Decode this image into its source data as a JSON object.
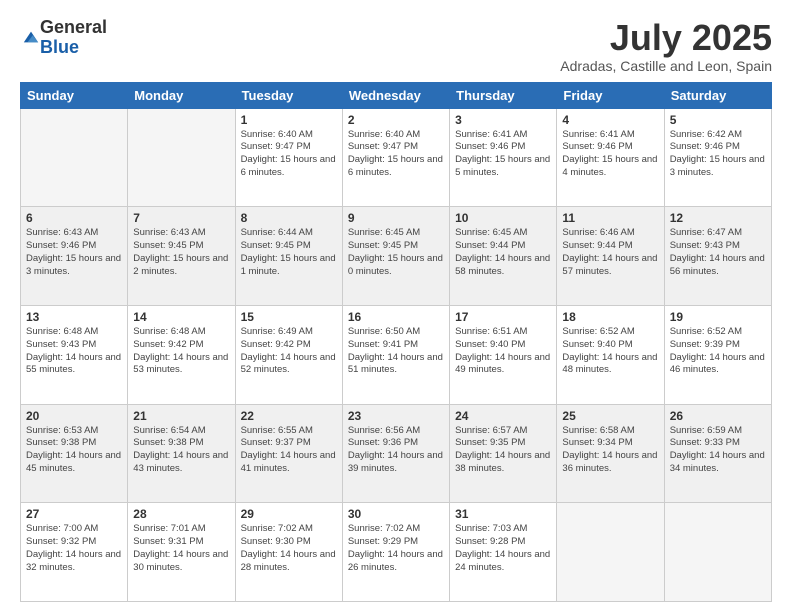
{
  "logo": {
    "general": "General",
    "blue": "Blue"
  },
  "title": "July 2025",
  "location": "Adradas, Castille and Leon, Spain",
  "weekdays": [
    "Sunday",
    "Monday",
    "Tuesday",
    "Wednesday",
    "Thursday",
    "Friday",
    "Saturday"
  ],
  "weeks": [
    [
      {
        "day": "",
        "text": ""
      },
      {
        "day": "",
        "text": ""
      },
      {
        "day": "1",
        "text": "Sunrise: 6:40 AM\nSunset: 9:47 PM\nDaylight: 15 hours\nand 6 minutes."
      },
      {
        "day": "2",
        "text": "Sunrise: 6:40 AM\nSunset: 9:47 PM\nDaylight: 15 hours\nand 6 minutes."
      },
      {
        "day": "3",
        "text": "Sunrise: 6:41 AM\nSunset: 9:46 PM\nDaylight: 15 hours\nand 5 minutes."
      },
      {
        "day": "4",
        "text": "Sunrise: 6:41 AM\nSunset: 9:46 PM\nDaylight: 15 hours\nand 4 minutes."
      },
      {
        "day": "5",
        "text": "Sunrise: 6:42 AM\nSunset: 9:46 PM\nDaylight: 15 hours\nand 3 minutes."
      }
    ],
    [
      {
        "day": "6",
        "text": "Sunrise: 6:43 AM\nSunset: 9:46 PM\nDaylight: 15 hours\nand 3 minutes."
      },
      {
        "day": "7",
        "text": "Sunrise: 6:43 AM\nSunset: 9:45 PM\nDaylight: 15 hours\nand 2 minutes."
      },
      {
        "day": "8",
        "text": "Sunrise: 6:44 AM\nSunset: 9:45 PM\nDaylight: 15 hours\nand 1 minute."
      },
      {
        "day": "9",
        "text": "Sunrise: 6:45 AM\nSunset: 9:45 PM\nDaylight: 15 hours\nand 0 minutes."
      },
      {
        "day": "10",
        "text": "Sunrise: 6:45 AM\nSunset: 9:44 PM\nDaylight: 14 hours\nand 58 minutes."
      },
      {
        "day": "11",
        "text": "Sunrise: 6:46 AM\nSunset: 9:44 PM\nDaylight: 14 hours\nand 57 minutes."
      },
      {
        "day": "12",
        "text": "Sunrise: 6:47 AM\nSunset: 9:43 PM\nDaylight: 14 hours\nand 56 minutes."
      }
    ],
    [
      {
        "day": "13",
        "text": "Sunrise: 6:48 AM\nSunset: 9:43 PM\nDaylight: 14 hours\nand 55 minutes."
      },
      {
        "day": "14",
        "text": "Sunrise: 6:48 AM\nSunset: 9:42 PM\nDaylight: 14 hours\nand 53 minutes."
      },
      {
        "day": "15",
        "text": "Sunrise: 6:49 AM\nSunset: 9:42 PM\nDaylight: 14 hours\nand 52 minutes."
      },
      {
        "day": "16",
        "text": "Sunrise: 6:50 AM\nSunset: 9:41 PM\nDaylight: 14 hours\nand 51 minutes."
      },
      {
        "day": "17",
        "text": "Sunrise: 6:51 AM\nSunset: 9:40 PM\nDaylight: 14 hours\nand 49 minutes."
      },
      {
        "day": "18",
        "text": "Sunrise: 6:52 AM\nSunset: 9:40 PM\nDaylight: 14 hours\nand 48 minutes."
      },
      {
        "day": "19",
        "text": "Sunrise: 6:52 AM\nSunset: 9:39 PM\nDaylight: 14 hours\nand 46 minutes."
      }
    ],
    [
      {
        "day": "20",
        "text": "Sunrise: 6:53 AM\nSunset: 9:38 PM\nDaylight: 14 hours\nand 45 minutes."
      },
      {
        "day": "21",
        "text": "Sunrise: 6:54 AM\nSunset: 9:38 PM\nDaylight: 14 hours\nand 43 minutes."
      },
      {
        "day": "22",
        "text": "Sunrise: 6:55 AM\nSunset: 9:37 PM\nDaylight: 14 hours\nand 41 minutes."
      },
      {
        "day": "23",
        "text": "Sunrise: 6:56 AM\nSunset: 9:36 PM\nDaylight: 14 hours\nand 39 minutes."
      },
      {
        "day": "24",
        "text": "Sunrise: 6:57 AM\nSunset: 9:35 PM\nDaylight: 14 hours\nand 38 minutes."
      },
      {
        "day": "25",
        "text": "Sunrise: 6:58 AM\nSunset: 9:34 PM\nDaylight: 14 hours\nand 36 minutes."
      },
      {
        "day": "26",
        "text": "Sunrise: 6:59 AM\nSunset: 9:33 PM\nDaylight: 14 hours\nand 34 minutes."
      }
    ],
    [
      {
        "day": "27",
        "text": "Sunrise: 7:00 AM\nSunset: 9:32 PM\nDaylight: 14 hours\nand 32 minutes."
      },
      {
        "day": "28",
        "text": "Sunrise: 7:01 AM\nSunset: 9:31 PM\nDaylight: 14 hours\nand 30 minutes."
      },
      {
        "day": "29",
        "text": "Sunrise: 7:02 AM\nSunset: 9:30 PM\nDaylight: 14 hours\nand 28 minutes."
      },
      {
        "day": "30",
        "text": "Sunrise: 7:02 AM\nSunset: 9:29 PM\nDaylight: 14 hours\nand 26 minutes."
      },
      {
        "day": "31",
        "text": "Sunrise: 7:03 AM\nSunset: 9:28 PM\nDaylight: 14 hours\nand 24 minutes."
      },
      {
        "day": "",
        "text": ""
      },
      {
        "day": "",
        "text": ""
      }
    ]
  ]
}
